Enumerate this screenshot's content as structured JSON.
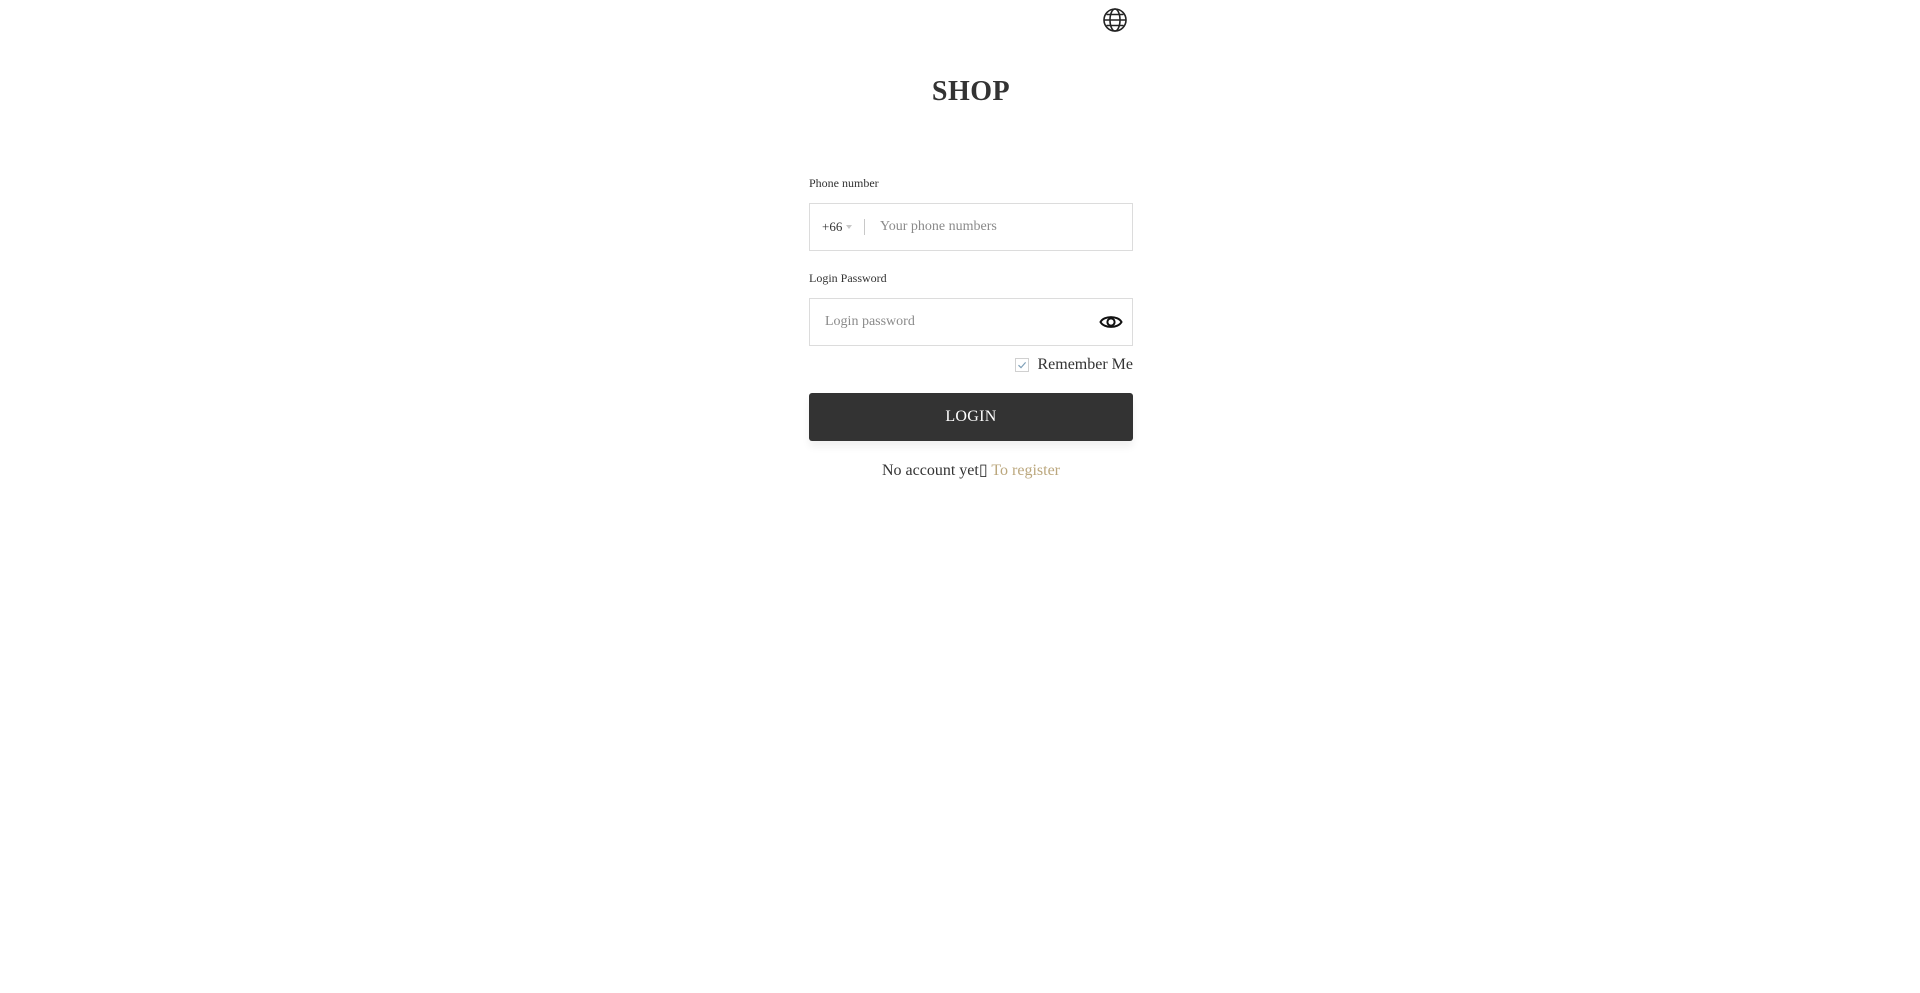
{
  "header": {
    "language_icon": "globe-icon",
    "title": "SHOP"
  },
  "form": {
    "phone": {
      "label": "Phone number",
      "country_code": "+66",
      "placeholder": "Your phone numbers",
      "value": ""
    },
    "password": {
      "label": "Login Password",
      "placeholder": "Login password",
      "value": "",
      "toggle_icon": "eye-icon"
    },
    "remember": {
      "label": "Remember Me",
      "checked": true
    },
    "submit_label": "LOGIN",
    "register_prompt": "No account yet",
    "register_link": "To register"
  },
  "colors": {
    "primary_button": "#333333",
    "link": "#bba77d",
    "border": "#dcdcdc"
  }
}
